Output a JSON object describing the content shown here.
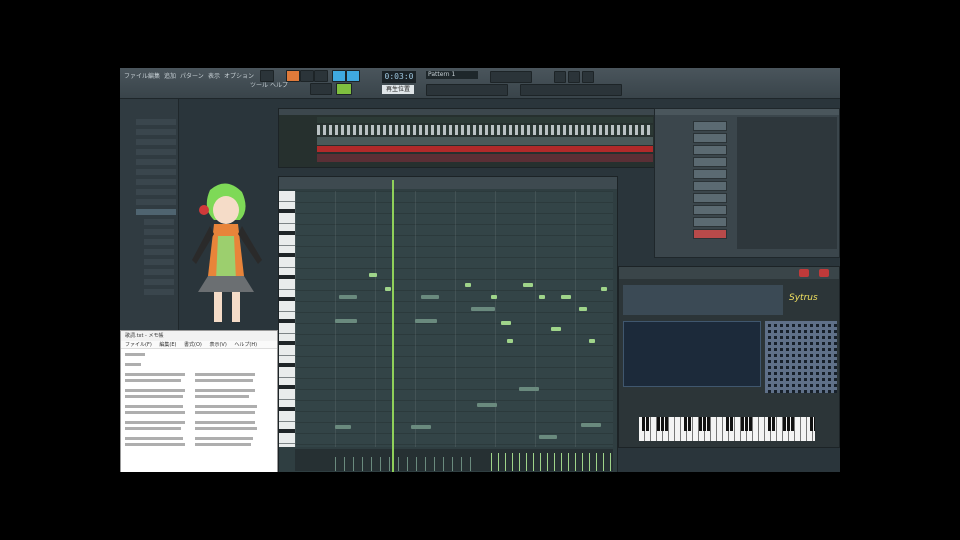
{
  "app": {
    "menu": [
      "ファイル",
      "編集",
      "追加",
      "パターン",
      "表示",
      "オプション",
      "ツール",
      "ヘルプ"
    ],
    "toolbar_label": "再生位置",
    "tempo": "0:03:0",
    "pattern_name": "Pattern 1"
  },
  "notepad": {
    "title": "歌詞.txt - メモ帳",
    "menu": [
      "ファイル(F)",
      "編集(E)",
      "書式(O)",
      "表示(V)",
      "ヘルプ(H)"
    ]
  },
  "plugin": {
    "logo": "Sytrus"
  },
  "colors": {
    "accent_orange": "#e07a3a",
    "accent_blue": "#3fa9e0",
    "note_green": "#9fd48a",
    "playhead_green": "#8fd05a",
    "playlist_red": "#b02a2a"
  }
}
